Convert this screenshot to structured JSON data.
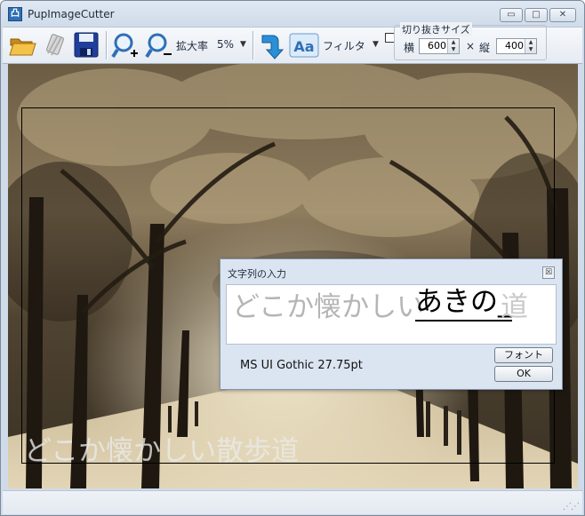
{
  "window": {
    "title": "PupImageCutter",
    "app_icon_glyph": "凸",
    "controls": {
      "minimize": "▭",
      "maximize": "□",
      "close": "✕"
    }
  },
  "toolbar": {
    "zoom_label": "拡大率",
    "zoom_value": "5%",
    "filter_label": "フィルタ",
    "text_tool_glyph": "Aa",
    "crop_size": {
      "group_label": "切り抜きサイズ",
      "width_label": "横",
      "width_value": "600",
      "times": "×",
      "height_label": "縦",
      "height_value": "400"
    },
    "icons": [
      "open-folder-icon",
      "clip-icon",
      "save-disk-icon",
      "zoom-in-icon",
      "zoom-out-icon",
      "rotate-arrow-icon",
      "text-tool-icon"
    ]
  },
  "canvas": {
    "overlay_text": "どこか懐かしい散歩道"
  },
  "dialog": {
    "title": "文字列の入力",
    "close_glyph": "☒",
    "committed_text": "どこか懐かしい",
    "composing_text": "あきの_",
    "trailing_char": "道",
    "font_info": "MS UI Gothic 27.75pt",
    "font_button": "フォント",
    "ok_button": "OK"
  },
  "colors": {
    "sepia_light": "#e8d9b8",
    "sepia_mid": "#8c7a5c",
    "sepia_dark": "#2e2619",
    "accent_blue": "#2f6fb6"
  }
}
